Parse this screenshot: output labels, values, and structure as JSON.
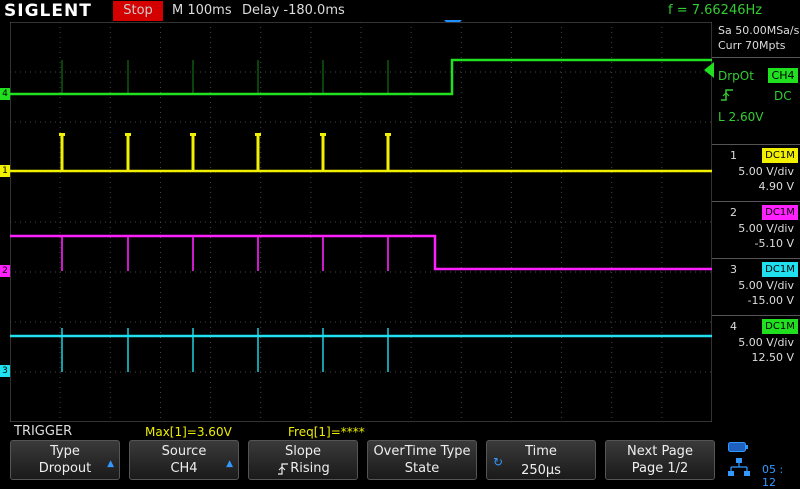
{
  "top": {
    "brand": "SIGLENT",
    "run_state": "Stop",
    "timebase": "M 100ms",
    "delay": "Delay -180.0ms",
    "frequency": "f = 7.66246Hz"
  },
  "acquisition": {
    "sample_rate": "Sa 50.00MSa/s",
    "memory": "Curr 70Mpts"
  },
  "trigger_panel": {
    "mode": "DrpOt",
    "source": "CH4",
    "coupling": "DC",
    "level": "L  2.60V"
  },
  "channels": [
    {
      "num": "1",
      "coupling": "DC1M",
      "vdiv": "5.00 V/div",
      "offset": "4.90 V",
      "color": "#f0f000"
    },
    {
      "num": "2",
      "coupling": "DC1M",
      "vdiv": "5.00 V/div",
      "offset": "-5.10 V",
      "color": "#ff20ff"
    },
    {
      "num": "3",
      "coupling": "DC1M",
      "vdiv": "5.00 V/div",
      "offset": "-15.00 V",
      "color": "#20e0f0"
    },
    {
      "num": "4",
      "coupling": "DC1M",
      "vdiv": "5.00 V/div",
      "offset": "12.50 V",
      "color": "#20e020"
    }
  ],
  "measurements": {
    "label": "TRIGGER",
    "max": "Max[1]=3.60V",
    "freq": "Freq[1]=****"
  },
  "softkeys": [
    {
      "title": "Type",
      "value": "Dropout",
      "arrow": true
    },
    {
      "title": "Source",
      "value": "CH4",
      "arrow": true
    },
    {
      "title": "Slope",
      "value": "Rising",
      "arrow": false
    },
    {
      "title": "OverTime Type",
      "value": "State",
      "arrow": false
    },
    {
      "title": "Time",
      "value": "250µs",
      "arrow": false
    },
    {
      "title": "Next Page",
      "value": "Page 1/2",
      "arrow": false
    }
  ],
  "clock": "05 : 12"
}
